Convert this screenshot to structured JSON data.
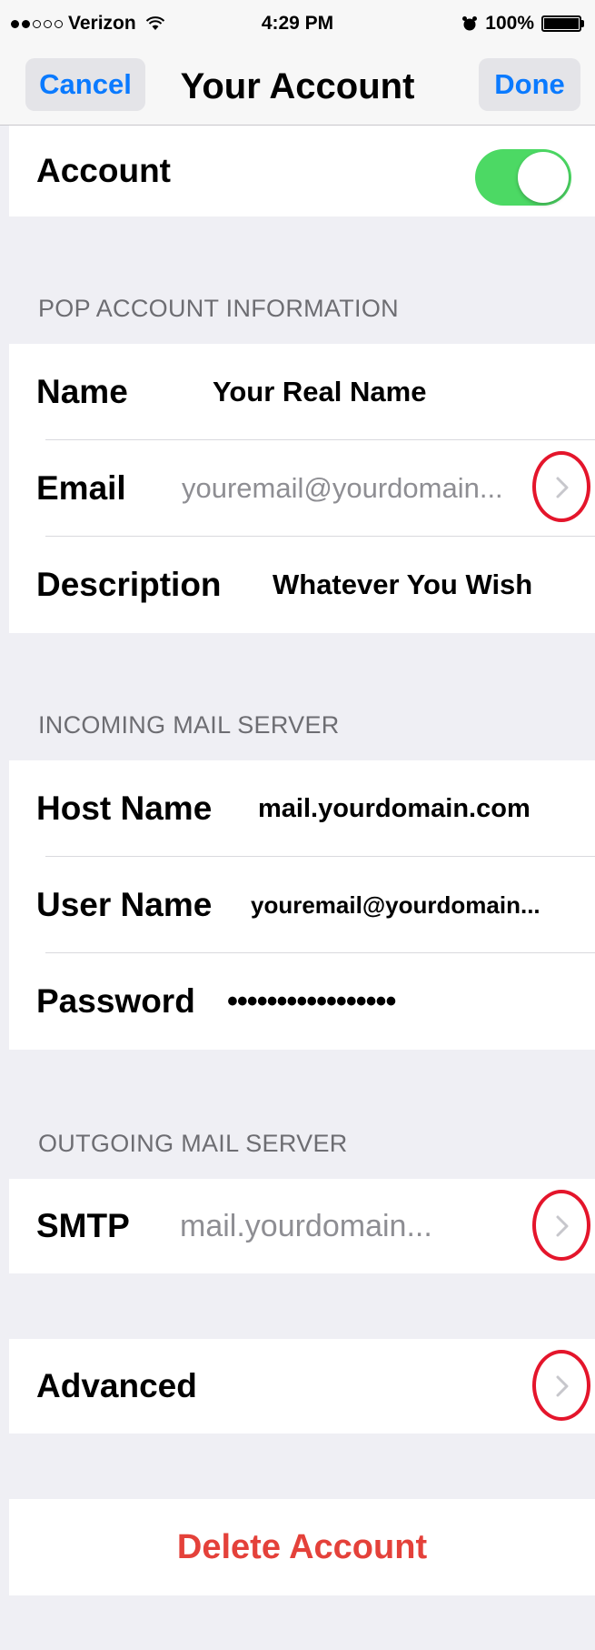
{
  "status_bar": {
    "carrier": "Verizon",
    "time": "4:29 PM",
    "battery": "100%"
  },
  "nav": {
    "cancel": "Cancel",
    "title": "Your Account",
    "done": "Done"
  },
  "account_toggle": {
    "label": "Account",
    "on": true
  },
  "pop_section": {
    "header": "POP ACCOUNT INFORMATION",
    "name_label": "Name",
    "name_value": "Your Real Name",
    "email_label": "Email",
    "email_value": "youremail@yourdomain...",
    "description_label": "Description",
    "description_value": "Whatever You Wish"
  },
  "incoming_section": {
    "header": "INCOMING MAIL SERVER",
    "host_label": "Host Name",
    "host_value": "mail.yourdomain.com",
    "user_label": "User Name",
    "user_value": "youremail@yourdomain...",
    "password_label": "Password",
    "password_value": "•••••••••••••••••"
  },
  "outgoing_section": {
    "header": "OUTGOING MAIL SERVER",
    "smtp_label": "SMTP",
    "smtp_value": "mail.yourdomain..."
  },
  "advanced": {
    "label": "Advanced"
  },
  "delete": {
    "label": "Delete Account"
  },
  "colors": {
    "accent_blue": "#0a7aff",
    "toggle_green": "#4cd964",
    "destructive_red": "#e4413a",
    "annotation_red": "#e4152b",
    "background": "#efeff4"
  }
}
